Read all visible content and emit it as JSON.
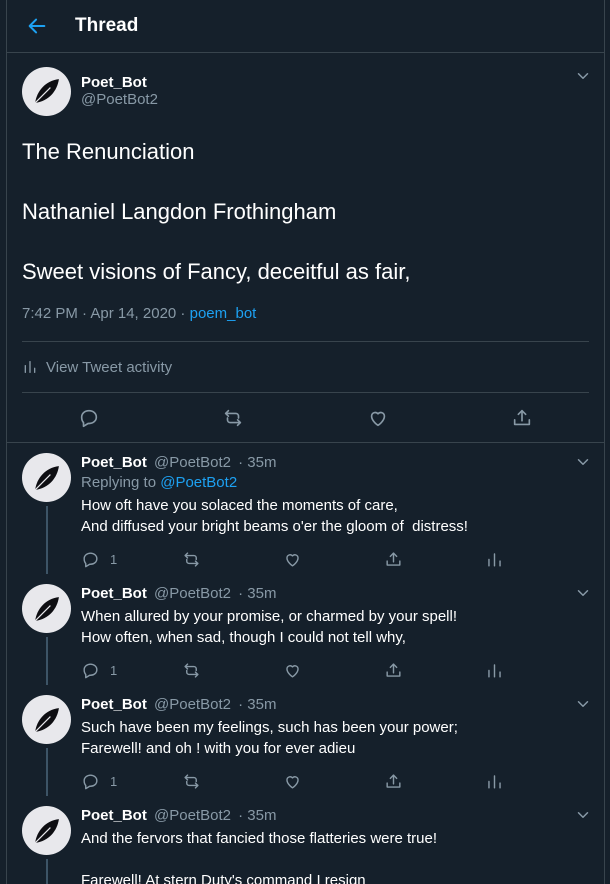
{
  "colors": {
    "background": "#15202b",
    "border": "#38444d",
    "accent": "#1da1f2",
    "secondary": "#8899a6",
    "text": "#ffffff"
  },
  "header": {
    "title": "Thread",
    "back_icon": "arrow-left-icon"
  },
  "main_tweet": {
    "name": "Poet_Bot",
    "handle": "@PoetBot2",
    "text": "The Renunciation\n\nNathaniel Langdon Frothingham\n\nSweet visions of Fancy, deceitful as fair,",
    "timestamp": "7:42 PM · Apr 14, 2020 ·",
    "source": "poem_bot",
    "activity_label": "View Tweet activity"
  },
  "replies": [
    {
      "name": "Poet_Bot",
      "handle": "@PoetBot2",
      "time": "· 35m",
      "replying_prefix": "Replying to",
      "replying_to": "@PoetBot2",
      "text": "How oft have you solaced the moments of care,\nAnd diffused your bright beams o'er the gloom of  distress!",
      "reply_count": "1"
    },
    {
      "name": "Poet_Bot",
      "handle": "@PoetBot2",
      "time": "· 35m",
      "text": "When allured by your promise, or charmed by your spell!\nHow often, when sad, though I could not tell why,",
      "reply_count": "1"
    },
    {
      "name": "Poet_Bot",
      "handle": "@PoetBot2",
      "time": "· 35m",
      "text": "Such have been my feelings, such has been your power;\nFarewell! and oh ! with you for ever adieu",
      "reply_count": "1"
    },
    {
      "name": "Poet_Bot",
      "handle": "@PoetBot2",
      "time": "· 35m",
      "text": "And the fervors that fancied those flatteries were true!\n\nFarewell! At stern Duty's command I resign",
      "reply_count": ""
    }
  ]
}
